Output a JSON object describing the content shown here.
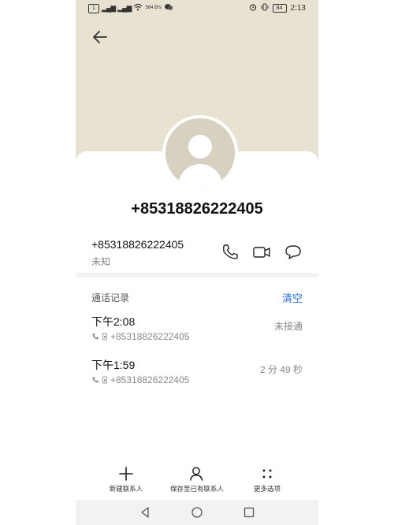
{
  "status_bar": {
    "time": "2:13",
    "net_speed": "564 B/s",
    "battery": "84"
  },
  "contact": {
    "number_title": "+85318826222405",
    "number": "+85318826222405",
    "label": "未知"
  },
  "call_log": {
    "header": "通话记录",
    "clear_label": "清空",
    "entries": [
      {
        "time": "下午2:08",
        "number": "+85318826222405",
        "status": "未接通"
      },
      {
        "time": "下午1:59",
        "number": "+85318826222405",
        "status": "2 分 49 秒"
      }
    ]
  },
  "bottom_actions": {
    "new_contact": "新建联系人",
    "save_existing": "保存至已有联系人",
    "more": "更多选项"
  },
  "icons": [
    "back-arrow-icon",
    "phone-icon",
    "video-call-icon",
    "message-icon",
    "plus-icon",
    "person-icon",
    "more-dots-icon"
  ]
}
